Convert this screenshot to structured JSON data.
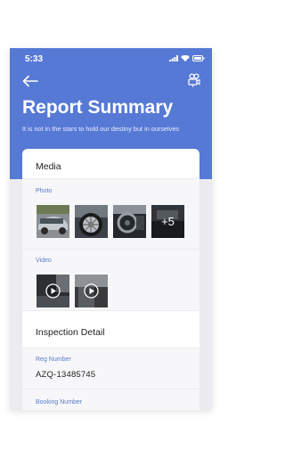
{
  "status_bar": {
    "time": "5:33"
  },
  "header": {
    "title": "Report Summary",
    "subtitle": "It is not in the stars to hold our destiny but in ourselves",
    "back_icon": "back-arrow-icon",
    "action_icon": "video-camera-icon"
  },
  "media": {
    "section_title": "Media",
    "photo_label": "Photo",
    "photos": [
      "car-front-photo",
      "car-wheel-photo",
      "car-interior-photo",
      "car-more-photo"
    ],
    "more_count": "+5",
    "video_label": "Video",
    "videos": [
      "car-video-1",
      "car-video-2"
    ]
  },
  "inspection": {
    "section_title": "Inspection Detail",
    "reg_label": "Reg Number",
    "reg_value": "AZQ-13485745",
    "booking_label": "Booking Number"
  },
  "colors": {
    "primary": "#5679d6",
    "accent_text": "#5b7bc9"
  }
}
